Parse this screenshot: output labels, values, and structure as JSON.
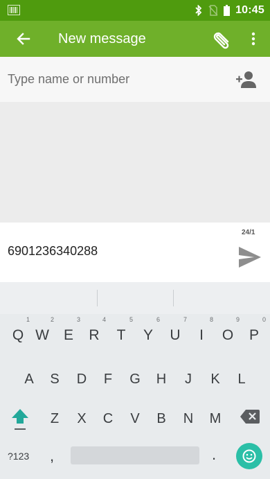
{
  "status_bar": {
    "time": "10:45",
    "icons": [
      "barcode-scanner-icon",
      "bluetooth-icon",
      "no-sim-icon",
      "battery-icon"
    ]
  },
  "app_bar": {
    "title": "New message",
    "icons": [
      "back-arrow-icon",
      "paperclip-icon",
      "more-vert-icon"
    ]
  },
  "recipient": {
    "placeholder": "Type name or number",
    "icon": "add-contact-icon"
  },
  "compose": {
    "text": "6901236340288",
    "counter": "24/1",
    "send_icon": "send-icon"
  },
  "keyboard": {
    "row1": [
      {
        "label": "Q",
        "hint": "1"
      },
      {
        "label": "W",
        "hint": "2"
      },
      {
        "label": "E",
        "hint": "3"
      },
      {
        "label": "R",
        "hint": "4"
      },
      {
        "label": "T",
        "hint": "5"
      },
      {
        "label": "Y",
        "hint": "6"
      },
      {
        "label": "U",
        "hint": "7"
      },
      {
        "label": "I",
        "hint": "8"
      },
      {
        "label": "O",
        "hint": "9"
      },
      {
        "label": "P",
        "hint": "0"
      }
    ],
    "row2": [
      "A",
      "S",
      "D",
      "F",
      "G",
      "H",
      "J",
      "K",
      "L"
    ],
    "row3": [
      "Z",
      "X",
      "C",
      "V",
      "B",
      "N",
      "M"
    ],
    "symbols_label": "?123",
    "comma": ",",
    "period": ".",
    "accent_color": "#2bbfa7",
    "shift_color": "#22a89a"
  },
  "colors": {
    "status_bar": "#4f9b0e",
    "app_bar": "#6fb02a",
    "thread_background": "#ececec",
    "keyboard_background": "#e8ebed"
  }
}
